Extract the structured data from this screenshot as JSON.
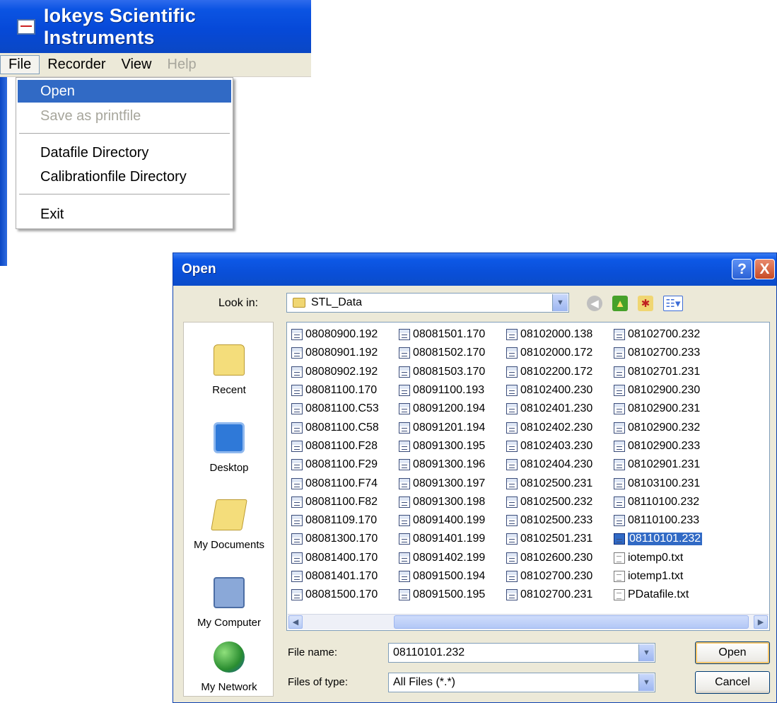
{
  "app": {
    "title": "Iokeys Scientific Instruments",
    "menu": [
      "File",
      "Recorder",
      "View",
      "Help"
    ],
    "file_menu": {
      "open": "Open",
      "save_printfile": "Save as printfile",
      "datafile_directory": "Datafile Directory",
      "calibrationfile_directory": "Calibrationfile Directory",
      "exit": "Exit"
    }
  },
  "dialog": {
    "title": "Open",
    "help_button": "?",
    "close_button": "X",
    "look_in_label": "Look in:",
    "look_in_value": "STL_Data",
    "places": [
      "Recent",
      "Desktop",
      "My Documents",
      "My Computer",
      "My Network"
    ],
    "files": [
      [
        "08080900.192",
        "08080901.192",
        "08080902.192",
        "08081100.170",
        "08081100.C53",
        "08081100.C58",
        "08081100.F28",
        "08081100.F29",
        "08081100.F74",
        "08081100.F82",
        "08081109.170",
        "08081300.170",
        "08081400.170",
        "08081401.170",
        "08081500.170"
      ],
      [
        "08081501.170",
        "08081502.170",
        "08081503.170",
        "08091100.193",
        "08091200.194",
        "08091201.194",
        "08091300.195",
        "08091300.196",
        "08091300.197",
        "08091300.198",
        "08091400.199",
        "08091401.199",
        "08091402.199",
        "08091500.194",
        "08091500.195"
      ],
      [
        "08102000.138",
        "08102000.172",
        "08102200.172",
        "08102400.230",
        "08102401.230",
        "08102402.230",
        "08102403.230",
        "08102404.230",
        "08102500.231",
        "08102500.232",
        "08102500.233",
        "08102501.231",
        "08102600.230",
        "08102700.230",
        "08102700.231"
      ],
      [
        "08102700.232",
        "08102700.233",
        "08102701.231",
        "08102900.230",
        "08102900.231",
        "08102900.232",
        "08102900.233",
        "08102901.231",
        "08103100.231",
        "08110100.232",
        "08110100.233",
        "08110101.232",
        "iotemp0.txt",
        "iotemp1.txt",
        "PDatafile.txt"
      ]
    ],
    "selected_file": "08110101.232",
    "file_name_label": "File name:",
    "file_name_value": "08110101.232",
    "file_type_label": "Files of type:",
    "file_type_value": "All Files (*.*)",
    "open_button": "Open",
    "cancel_button": "Cancel"
  },
  "colors": {
    "title_blue": "#0a4fd8",
    "selection": "#316ac5",
    "face": "#ece9d8"
  }
}
